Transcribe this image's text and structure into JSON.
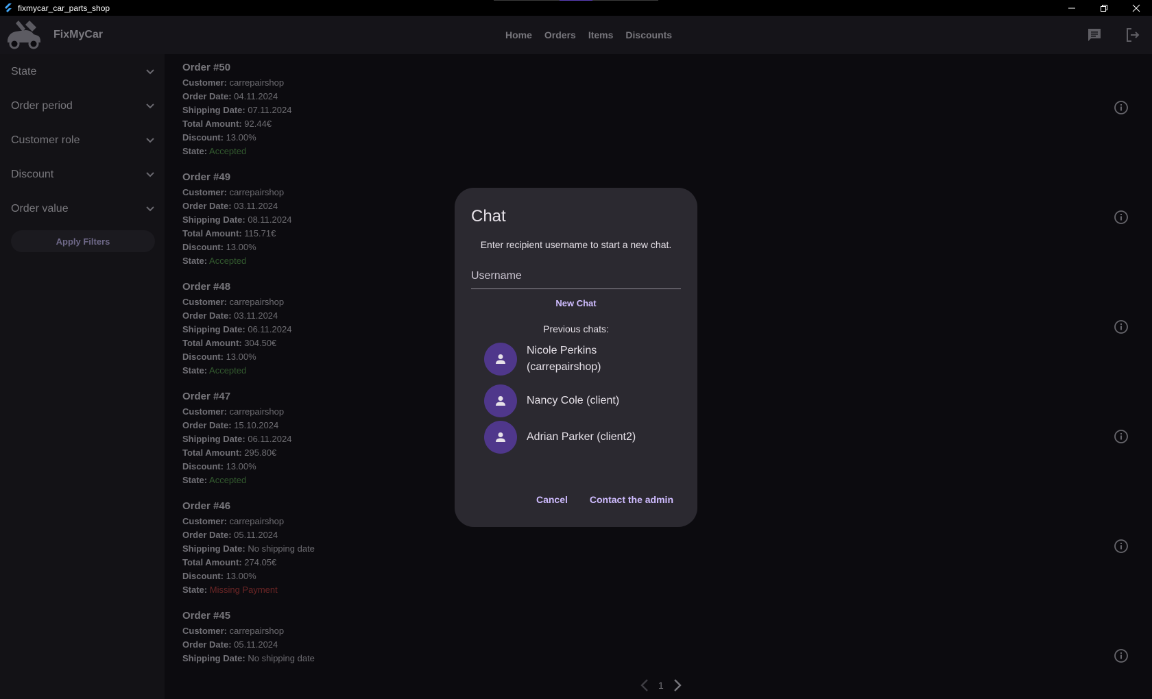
{
  "window": {
    "title": "fixmycar_car_parts_shop"
  },
  "header": {
    "brand": "FixMyCar",
    "nav": [
      "Home",
      "Orders",
      "Items",
      "Discounts"
    ]
  },
  "sidebar": {
    "filters": [
      "State",
      "Order period",
      "Customer role",
      "Discount",
      "Order value"
    ],
    "apply_label": "Apply Filters"
  },
  "labels": {
    "customer": "Customer:",
    "order_date": "Order Date:",
    "shipping_date": "Shipping Date:",
    "total_amount": "Total Amount:",
    "discount": "Discount:",
    "state": "State:"
  },
  "orders": [
    {
      "title": "Order #50",
      "customer": "carrepairshop",
      "order_date": "04.11.2024",
      "shipping_date": "07.11.2024",
      "total": "92.44€",
      "discount": "13.00%",
      "state": "Accepted"
    },
    {
      "title": "Order #49",
      "customer": "carrepairshop",
      "order_date": "03.11.2024",
      "shipping_date": "08.11.2024",
      "total": "115.71€",
      "discount": "13.00%",
      "state": "Accepted"
    },
    {
      "title": "Order #48",
      "customer": "carrepairshop",
      "order_date": "03.11.2024",
      "shipping_date": "06.11.2024",
      "total": "304.50€",
      "discount": "13.00%",
      "state": "Accepted"
    },
    {
      "title": "Order #47",
      "customer": "carrepairshop",
      "order_date": "15.10.2024",
      "shipping_date": "06.11.2024",
      "total": "295.80€",
      "discount": "13.00%",
      "state": "Accepted"
    },
    {
      "title": "Order #46",
      "customer": "carrepairshop",
      "order_date": "05.11.2024",
      "shipping_date": "No shipping date",
      "total": "274.05€",
      "discount": "13.00%",
      "state": "Missing Payment"
    },
    {
      "title": "Order #45",
      "customer": "carrepairshop",
      "order_date": "05.11.2024",
      "shipping_date": "No shipping date",
      "total": "",
      "discount": "",
      "state": ""
    }
  ],
  "pagination": {
    "page": "1"
  },
  "dialog": {
    "title": "Chat",
    "description": "Enter recipient username to start a new chat.",
    "username_placeholder": "Username",
    "new_chat_label": "New Chat",
    "previous_label": "Previous chats:",
    "chats": [
      {
        "line1": "Nicole Perkins",
        "line2": "(carrepairshop)"
      },
      {
        "line1": "Nancy Cole (client)",
        "line2": ""
      },
      {
        "line1": "Adrian Parker (client2)",
        "line2": ""
      }
    ],
    "cancel_label": "Cancel",
    "contact_admin_label": "Contact the admin"
  },
  "colors": {
    "accepted": "#335a2f",
    "missing_payment": "#6d2626",
    "accent": "#cfbcff",
    "avatar_bg": "#4f378b",
    "dialog_bg": "#2b2930"
  },
  "icons": {
    "app": "flutter-icon",
    "logo": "car-wrench-logo",
    "chat": "chat-icon",
    "logout": "logout-icon",
    "info": "info-icon",
    "chevron": "chevron-down-icon",
    "person": "person-icon",
    "prev": "chevron-left-icon",
    "next": "chevron-right-icon"
  }
}
